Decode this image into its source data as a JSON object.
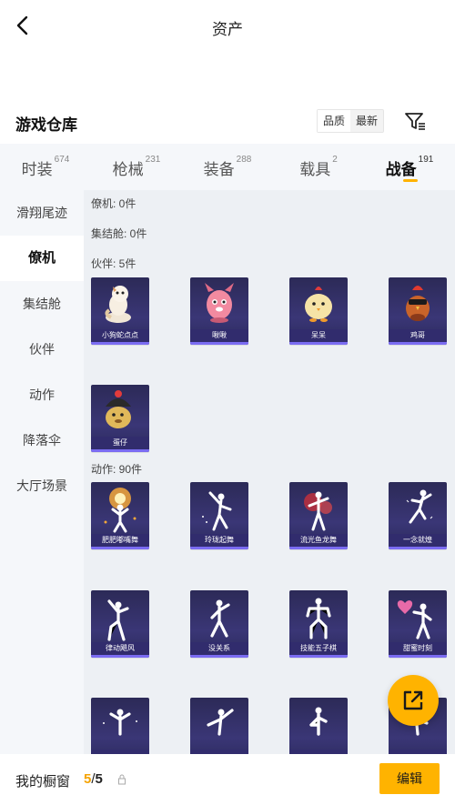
{
  "header": {
    "title": "资产"
  },
  "section": {
    "title": "游戏仓库"
  },
  "sort": {
    "quality_label": "品质",
    "latest_label": "最新"
  },
  "tabs": [
    {
      "label": "时装",
      "count": "674"
    },
    {
      "label": "枪械",
      "count": "231"
    },
    {
      "label": "装备",
      "count": "288"
    },
    {
      "label": "载具",
      "count": "2"
    },
    {
      "label": "战备",
      "count": "191"
    }
  ],
  "sidebar": {
    "items": [
      "滑翔尾迹",
      "僚机",
      "集结舱",
      "伙伴",
      "动作",
      "降落伞",
      "大厅场景"
    ]
  },
  "groups": {
    "liaoji": "僚机: 0件",
    "jijie": "集结舱: 0件",
    "huoban": "伙伴: 5件",
    "dongzuo": "动作: 90件"
  },
  "partners": [
    "小狗蛇点点",
    "啾啾",
    "呆呆",
    "鸡哥",
    "蛋仔"
  ],
  "emotes": [
    "肥肥嘟嘴舞",
    "玲珑起舞",
    "流光鱼龙舞",
    "一念就煌",
    "律动飓风",
    "没关系",
    "技能五子棋",
    "甜蜜时刻",
    "",
    "",
    "",
    ""
  ],
  "bottom": {
    "showcase_label": "我的橱窗",
    "current": "5",
    "separator": "/",
    "total": "5",
    "edit_label": "编辑"
  },
  "colors": {
    "accent": "#ffb300",
    "card_bg": "#2c2a57",
    "card_strip": "#7b6cf2"
  },
  "icons": {
    "back": "chevron-left-icon",
    "filter": "filter-icon",
    "fab": "share-out-icon",
    "lock": "lock-icon"
  }
}
